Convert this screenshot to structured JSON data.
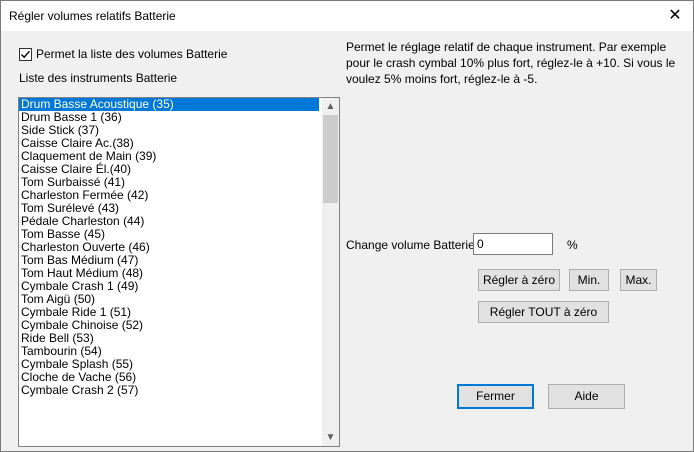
{
  "window": {
    "title": "Régler volumes relatifs Batterie",
    "close_symbol": "✕"
  },
  "enable_checkbox": {
    "label": "Permet la liste des volumes Batterie",
    "checked": true
  },
  "list_label": "Liste des instruments Batterie",
  "instruments": [
    "Drum Basse Acoustique (35)",
    "Drum Basse 1 (36)",
    "Side Stick (37)",
    "Caisse Claire Ac.(38)",
    "Claquement de Main (39)",
    "Caisse Claire Él.(40)",
    "Tom Surbaissé (41)",
    "Charleston Fermée (42)",
    "Tom Surélevé (43)",
    "Pédale Charleston (44)",
    "Tom Basse (45)",
    "Charleston Ouverte (46)",
    "Tom Bas Médium (47)",
    "Tom Haut Médium (48)",
    "Cymbale Crash 1 (49)",
    "Tom Aigü (50)",
    "Cymbale Ride 1 (51)",
    "Cymbale Chinoise (52)",
    "Ride Bell (53)",
    "Tambourin (54)",
    "Cymbale Splash (55)",
    "Cloche de Vache (56)",
    "Cymbale Crash 2 (57)"
  ],
  "selected_index": 0,
  "description": "Permet le réglage relatif de chaque instrument. Par exemple pour le crash cymbal 10% plus fort, réglez-le à +10. Si vous le voulez 5% moins fort, réglez-le à -5.",
  "change": {
    "label": "Change volume Batterie de",
    "value": "0",
    "unit": "%"
  },
  "buttons": {
    "reset": "Régler à zéro",
    "min": "Min.",
    "max": "Max.",
    "reset_all": "Régler TOUT à zéro",
    "close": "Fermer",
    "help": "Aide"
  },
  "colors": {
    "selection": "#0078d7",
    "dialog_bg": "#f0f0f0"
  }
}
